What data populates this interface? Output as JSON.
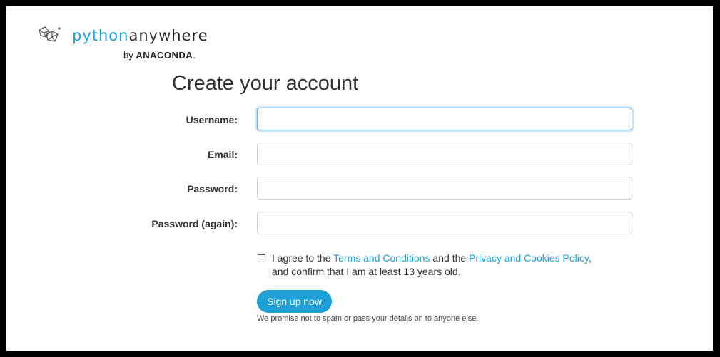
{
  "brand": {
    "logo_icon": "pythonanywhere-logo-icon",
    "name_part1": "python",
    "name_part2": "anywhere",
    "by_text": "by",
    "by_brand": "ANACONDA",
    "by_suffix": ".",
    "colors": {
      "accent": "#1d9fd8",
      "text": "#333333"
    }
  },
  "page": {
    "title": "Create your account"
  },
  "form": {
    "fields": [
      {
        "label": "Username:",
        "value": "",
        "focused": true
      },
      {
        "label": "Email:",
        "value": ""
      },
      {
        "label": "Password:",
        "value": ""
      },
      {
        "label": "Password (again):",
        "value": ""
      }
    ],
    "agree": {
      "checked": false,
      "text_before": "I agree to the ",
      "terms_link": "Terms and Conditions",
      "text_middle": " and the ",
      "privacy_link": "Privacy and Cookies Policy",
      "text_after": ",",
      "line2": "and confirm that I am at least 13 years old."
    },
    "submit_label": "Sign up now",
    "promise_text": "We promise not to spam or pass your details on to anyone else."
  }
}
